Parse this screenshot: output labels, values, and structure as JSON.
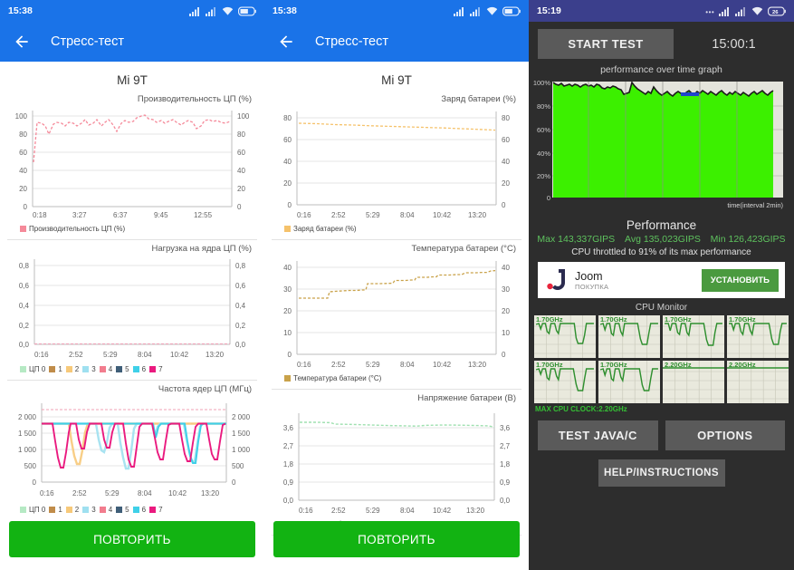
{
  "panel_a": {
    "status_bar": {
      "time": "15:38",
      "icons": [
        "signal-icon",
        "signal-icon",
        "wifi-icon",
        "battery-icon"
      ]
    },
    "app_bar": {
      "back_icon": "back-arrow-icon",
      "title": "Стресс-тест"
    },
    "device_title": "Mi 9T",
    "repeat_label": "ПОВТОРИТЬ",
    "charts": [
      {
        "caption": "Производительность ЦП (%)",
        "legend": [
          {
            "label": "Производительность ЦП (%)",
            "color": "#f58a9a"
          }
        ]
      },
      {
        "caption": "Нагрузка на ядра ЦП (%)",
        "legend": [
          {
            "label": "ЦП 0",
            "color": "#b6e9c4"
          },
          {
            "label": "1",
            "color": "#c08c4a"
          },
          {
            "label": "2",
            "color": "#f7c97a"
          },
          {
            "label": "3",
            "color": "#9fe0f0"
          },
          {
            "label": "4",
            "color": "#f27d8e"
          },
          {
            "label": "5",
            "color": "#3f5e78"
          },
          {
            "label": "6",
            "color": "#3fd0e8"
          },
          {
            "label": "7",
            "color": "#ea1a7f"
          }
        ]
      },
      {
        "caption": "Частота ядер ЦП (МГц)",
        "legend": [
          {
            "label": "ЦП 0",
            "color": "#b6e9c4"
          },
          {
            "label": "1",
            "color": "#c08c4a"
          },
          {
            "label": "2",
            "color": "#f7c97a"
          },
          {
            "label": "3",
            "color": "#9fe0f0"
          },
          {
            "label": "4",
            "color": "#f27d8e"
          },
          {
            "label": "5",
            "color": "#3f5e78"
          },
          {
            "label": "6",
            "color": "#3fd0e8"
          },
          {
            "label": "7",
            "color": "#ea1a7f"
          }
        ]
      }
    ]
  },
  "panel_b": {
    "status_bar": {
      "time": "15:38"
    },
    "app_bar": {
      "title": "Стресс-тест"
    },
    "device_title": "Mi 9T",
    "repeat_label": "ПОВТОРИТЬ",
    "charts": [
      {
        "caption": "Заряд батареи (%)",
        "legend": [
          {
            "label": "Заряд батареи (%)",
            "color": "#f5c26b"
          }
        ]
      },
      {
        "caption": "Температура батареи (°C)",
        "legend": [
          {
            "label": "Температура батареи (°C)",
            "color": "#c9a24a"
          }
        ]
      },
      {
        "caption": "Напряжение батареи (В)",
        "legend": [
          {
            "label": "Напряжение батареи (В)",
            "color": "#9fe0b0"
          }
        ]
      }
    ]
  },
  "panel_c": {
    "status_bar": {
      "time": "15:19",
      "icons": [
        "dots-icon",
        "signal-icon",
        "signal-icon",
        "wifi-icon",
        "battery-icon"
      ]
    },
    "start_button": "START TEST",
    "timer": "15:00:1",
    "graph_title": "performance over time graph",
    "graph_x_label": "time(interval 2min)",
    "performance_title": "Performance",
    "stats": {
      "max": "Max 143,337GIPS",
      "avg": "Avg 135,023GIPS",
      "min": "Min 126,423GIPS"
    },
    "throttle_text": "CPU throttled to 91% of its max performance",
    "ad": {
      "name": "Joom",
      "subtitle": "ПОКУПКА",
      "button": "УСТАНОВИТЬ",
      "icon": "joom-logo-icon"
    },
    "monitor_title": "CPU Monitor",
    "cores": [
      {
        "freq": "1.70GHz"
      },
      {
        "freq": "1.70GHz"
      },
      {
        "freq": "1.70GHz"
      },
      {
        "freq": "1.70GHz"
      },
      {
        "freq": "1.70GHz"
      },
      {
        "freq": "1.70GHz"
      },
      {
        "freq": "2.20GHz"
      },
      {
        "freq": "2.20GHz"
      }
    ],
    "max_clock": "MAX CPU CLOCK:2.20GHz",
    "test_java_button": "TEST JAVA/C",
    "options_button": "OPTIONS",
    "help_button": "HELP/INSTRUCTIONS"
  },
  "chart_data": [
    {
      "type": "line",
      "title": "Производительность ЦП (%)",
      "xlabel": "",
      "ylabel": "%",
      "ylim": [
        0,
        100
      ],
      "yticks": [
        0,
        20,
        40,
        60,
        80,
        100
      ],
      "xticks": [
        "0:18",
        "3:27",
        "6:37",
        "9:45",
        "12:55"
      ],
      "grid": true,
      "legend_position": "bottom-left",
      "series": [
        {
          "name": "Производительность ЦП (%)",
          "color": "#f58a9a",
          "values": [
            49,
            93,
            92,
            88,
            80,
            90,
            93,
            92,
            88,
            93,
            92,
            88,
            92,
            95,
            89,
            92,
            95,
            88,
            93,
            95,
            90,
            83,
            92,
            94,
            92,
            93,
            96,
            98,
            99,
            95,
            94,
            92,
            94,
            91,
            93,
            95,
            92,
            89,
            92,
            94,
            92,
            85,
            88,
            94,
            95,
            93,
            94,
            92,
            91,
            93
          ]
        }
      ]
    },
    {
      "type": "line",
      "title": "Нагрузка на ядра ЦП (%)",
      "xlabel": "",
      "ylabel": "%",
      "ylim": [
        0.0,
        0.9
      ],
      "yticks": [
        "0,0",
        "0,2",
        "0,4",
        "0,6",
        "0,8"
      ],
      "xticks": [
        "0:16",
        "2:52",
        "5:29",
        "8:04",
        "10:42",
        "13:20"
      ],
      "grid": true,
      "legend_position": "bottom-left",
      "series": [
        {
          "name": "ЦП 0",
          "color": "#b6e9c4",
          "values": [
            0,
            0,
            0,
            0,
            0,
            0,
            0,
            0,
            0,
            0
          ]
        },
        {
          "name": "1",
          "color": "#c08c4a",
          "values": [
            0,
            0,
            0,
            0,
            0,
            0,
            0,
            0,
            0,
            0
          ]
        },
        {
          "name": "2",
          "color": "#f7c97a",
          "values": [
            0,
            0,
            0,
            0,
            0,
            0,
            0,
            0,
            0,
            0
          ]
        },
        {
          "name": "3",
          "color": "#9fe0f0",
          "values": [
            0,
            0,
            0,
            0,
            0,
            0,
            0,
            0,
            0,
            0
          ]
        },
        {
          "name": "4",
          "color": "#f27d8e",
          "values": [
            0,
            0,
            0,
            0,
            0,
            0,
            0,
            0,
            0,
            0
          ]
        },
        {
          "name": "5",
          "color": "#3f5e78",
          "values": [
            0,
            0,
            0,
            0,
            0,
            0,
            0,
            0,
            0,
            0
          ]
        },
        {
          "name": "6",
          "color": "#3fd0e8",
          "values": [
            0,
            0,
            0,
            0,
            0,
            0,
            0,
            0,
            0,
            0
          ]
        },
        {
          "name": "7",
          "color": "#ea1a7f",
          "values": [
            0,
            0,
            0,
            0,
            0,
            0,
            0,
            0,
            0,
            0
          ]
        }
      ]
    },
    {
      "type": "line",
      "title": "Частота ядер ЦП (МГц)",
      "xlabel": "",
      "ylabel": "МГц",
      "ylim": [
        0,
        2300
      ],
      "yticks": [
        0,
        500,
        "1 000",
        "1 500",
        "2 000"
      ],
      "xticks": [
        "0:16",
        "2:52",
        "5:29",
        "8:04",
        "10:42",
        "13:20"
      ],
      "grid": true,
      "legend_position": "bottom-left",
      "reference_lines": [
        2200,
        1800
      ],
      "notes": "Periodic dips from 1800MHz down to 550-1300MHz across cores",
      "series": [
        {
          "name": "ЦП 0",
          "color": "#b6e9c4",
          "values": [
            1800,
            1800,
            1800,
            1800,
            1800,
            1800,
            1800,
            1800
          ]
        },
        {
          "name": "7",
          "color": "#ea1a7f",
          "values": [
            1800,
            600,
            1800,
            1300,
            1800,
            1250,
            1800,
            750,
            1800,
            780,
            1800,
            1550,
            1800,
            800,
            1800
          ]
        }
      ]
    },
    {
      "type": "line",
      "title": "Заряд батареи (%)",
      "xlabel": "",
      "ylabel": "%",
      "ylim": [
        0,
        80
      ],
      "yticks": [
        0,
        20,
        40,
        60,
        80
      ],
      "xticks": [
        "0:16",
        "2:52",
        "5:29",
        "8:04",
        "10:42",
        "13:20"
      ],
      "grid": true,
      "legend_position": "bottom-left",
      "series": [
        {
          "name": "Заряд батареи (%)",
          "color": "#f5c26b",
          "values": [
            75,
            75,
            74,
            74,
            74,
            73,
            73,
            73,
            72,
            72,
            72,
            71,
            71,
            71,
            70,
            70,
            70,
            69,
            69,
            68
          ]
        }
      ]
    },
    {
      "type": "line",
      "title": "Температура батареи (°C)",
      "xlabel": "",
      "ylabel": "°C",
      "ylim": [
        0,
        40
      ],
      "yticks": [
        0,
        10,
        20,
        30,
        40
      ],
      "xticks": [
        "0:16",
        "2:52",
        "5:29",
        "8:04",
        "10:42",
        "13:20"
      ],
      "grid": true,
      "legend_position": "bottom-left",
      "series": [
        {
          "name": "Температура батареи (°C)",
          "color": "#c9a24a",
          "values": [
            26,
            26,
            26,
            26,
            26,
            29,
            29,
            30,
            30,
            30,
            30,
            32,
            32,
            32,
            32,
            33,
            34,
            34,
            34,
            35,
            35,
            35,
            36,
            36,
            36,
            37,
            37,
            38
          ]
        }
      ]
    },
    {
      "type": "line",
      "title": "Напряжение батареи (В)",
      "xlabel": "",
      "ylabel": "В",
      "ylim": [
        0.0,
        4.0
      ],
      "yticks": [
        "0,0",
        "0,9",
        "1,8",
        "2,7",
        "3,6"
      ],
      "xticks": [
        "0:16",
        "2:52",
        "5:29",
        "8:04",
        "10:42",
        "13:20"
      ],
      "grid": true,
      "legend_position": "bottom-left",
      "series": [
        {
          "name": "Напряжение батареи (В)",
          "color": "#9fe0b0",
          "values": [
            3.85,
            3.85,
            3.85,
            3.84,
            3.8,
            3.8,
            3.8,
            3.79,
            3.78,
            3.77,
            3.77,
            3.78,
            3.79,
            3.79,
            3.79,
            3.79,
            3.78,
            3.78,
            3.77,
            3.74
          ]
        }
      ]
    },
    {
      "type": "area",
      "title": "performance over time graph",
      "xlabel": "time(interval 2min)",
      "ylabel": "%",
      "ylim": [
        0,
        100
      ],
      "yticks": [
        "0",
        "20%",
        "40%",
        "60%",
        "80%",
        "100%"
      ],
      "grid": true,
      "legend_position": "none",
      "series": [
        {
          "name": "performance",
          "color": "#3cf000",
          "values": [
            100,
            98,
            97,
            99,
            96,
            97,
            98,
            96,
            98,
            97,
            95,
            97,
            98,
            96,
            97,
            96,
            98,
            97,
            95,
            94,
            96,
            95,
            97,
            96,
            94,
            93,
            100,
            98,
            96,
            94,
            93,
            92,
            94,
            93,
            91,
            92,
            93,
            91,
            90,
            92,
            93,
            91,
            92,
            94,
            93,
            91,
            92,
            93,
            91,
            92,
            94,
            92,
            91,
            93,
            94,
            92,
            91,
            90,
            92,
            93,
            91,
            92,
            91,
            93,
            92,
            94,
            93
          ]
        }
      ]
    }
  ]
}
